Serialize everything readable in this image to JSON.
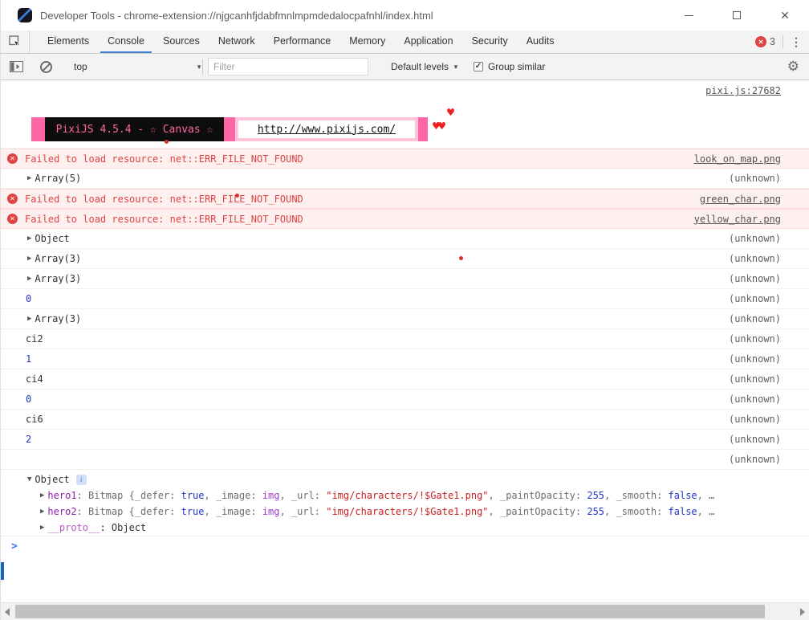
{
  "window": {
    "title": "Developer Tools - chrome-extension://njgcanhfjdabfmnlmpmdedalocpafnhl/index.html"
  },
  "icons": {
    "close": "✕",
    "error_badge": "✕",
    "check": "✓",
    "caret_down": "▼",
    "gear": "⚙",
    "kebab": "⋮",
    "info": "i",
    "prompt": ">",
    "heart_single": "♥",
    "heart_pair": "♥♥"
  },
  "tabs": {
    "items": [
      "Elements",
      "Console",
      "Sources",
      "Network",
      "Performance",
      "Memory",
      "Application",
      "Security",
      "Audits"
    ],
    "active": "Console",
    "error_count": "3"
  },
  "toolbar": {
    "context": "top",
    "filter_placeholder": "Filter",
    "levels_label": "Default levels",
    "group_similar_label": "Group similar",
    "group_similar_checked": true
  },
  "colors": {
    "accent_blue": "#437fd8",
    "error_red": "#df4343",
    "banner_pink": "#ff66a5",
    "banner_light_pink": "#ffc3dc"
  },
  "console": {
    "banner": {
      "source": "pixi.js:27682",
      "title": "PixiJS 4.5.4 - ☆ Canvas ☆",
      "url": "http://www.pixijs.com/"
    },
    "prompt": ">",
    "messages": [
      {
        "kind": "banner"
      },
      {
        "kind": "error",
        "text": "Failed to load resource: net::ERR_FILE_NOT_FOUND",
        "link": "look_on_map.png"
      },
      {
        "kind": "expand",
        "label": "Array(5)",
        "value": "(unknown)"
      },
      {
        "kind": "error",
        "text": "Failed to load resource: net::ERR_FILE_NOT_FOUND",
        "link": "green_char.png"
      },
      {
        "kind": "error",
        "text": "Failed to load resource: net::ERR_FILE_NOT_FOUND",
        "link": "yellow_char.png"
      },
      {
        "kind": "expand",
        "label": "Object",
        "value": "(unknown)"
      },
      {
        "kind": "expand",
        "label": "Array(3)",
        "value": "(unknown)"
      },
      {
        "kind": "expand",
        "label": "Array(3)",
        "value": "(unknown)"
      },
      {
        "kind": "value",
        "text": "0",
        "color": "blue",
        "value": "(unknown)"
      },
      {
        "kind": "expand",
        "label": "Array(3)",
        "value": "(unknown)"
      },
      {
        "kind": "value",
        "text": "ci2",
        "color": "plain",
        "value": "(unknown)"
      },
      {
        "kind": "value",
        "text": "1",
        "color": "blue",
        "value": "(unknown)"
      },
      {
        "kind": "value",
        "text": "ci4",
        "color": "plain",
        "value": "(unknown)"
      },
      {
        "kind": "value",
        "text": "0",
        "color": "blue",
        "value": "(unknown)"
      },
      {
        "kind": "value",
        "text": "ci6",
        "color": "plain",
        "value": "(unknown)"
      },
      {
        "kind": "value",
        "text": "2",
        "color": "blue",
        "value": "(unknown)"
      },
      {
        "kind": "value",
        "text": "",
        "color": "plain",
        "value": "(unknown)"
      },
      {
        "kind": "tree",
        "rows": [
          {
            "indent": 0,
            "arrow": "▼",
            "info": true,
            "tokens": [
              {
                "t": "Object",
                "c": "plain"
              }
            ]
          },
          {
            "indent": 1,
            "arrow": "▶",
            "tokens": [
              {
                "t": "hero1",
                "c": "purple"
              },
              {
                "t": ": Bitmap {_defer: ",
                "c": "gray"
              },
              {
                "t": "true",
                "c": "blue"
              },
              {
                "t": ", _image: ",
                "c": "gray"
              },
              {
                "t": "img",
                "c": "violet"
              },
              {
                "t": ", _url: ",
                "c": "gray"
              },
              {
                "t": "\"img/characters/!$Gate1.png\"",
                "c": "red"
              },
              {
                "t": ", _paintOpacity: ",
                "c": "gray"
              },
              {
                "t": "255",
                "c": "blue"
              },
              {
                "t": ", _smooth: ",
                "c": "gray"
              },
              {
                "t": "false",
                "c": "blue"
              },
              {
                "t": ", …",
                "c": "gray"
              }
            ]
          },
          {
            "indent": 1,
            "arrow": "▶",
            "tokens": [
              {
                "t": "hero2",
                "c": "purple"
              },
              {
                "t": ": Bitmap {_defer: ",
                "c": "gray"
              },
              {
                "t": "true",
                "c": "blue"
              },
              {
                "t": ", _image: ",
                "c": "gray"
              },
              {
                "t": "img",
                "c": "violet"
              },
              {
                "t": ", _url: ",
                "c": "gray"
              },
              {
                "t": "\"img/characters/!$Gate1.png\"",
                "c": "red"
              },
              {
                "t": ", _paintOpacity: ",
                "c": "gray"
              },
              {
                "t": "255",
                "c": "blue"
              },
              {
                "t": ", _smooth: ",
                "c": "gray"
              },
              {
                "t": "false",
                "c": "blue"
              },
              {
                "t": ", …",
                "c": "gray"
              }
            ]
          },
          {
            "indent": 1,
            "arrow": "▶",
            "tokens": [
              {
                "t": "__proto__",
                "c": "proto"
              },
              {
                "t": ": Object",
                "c": "plain"
              }
            ]
          }
        ]
      }
    ]
  }
}
